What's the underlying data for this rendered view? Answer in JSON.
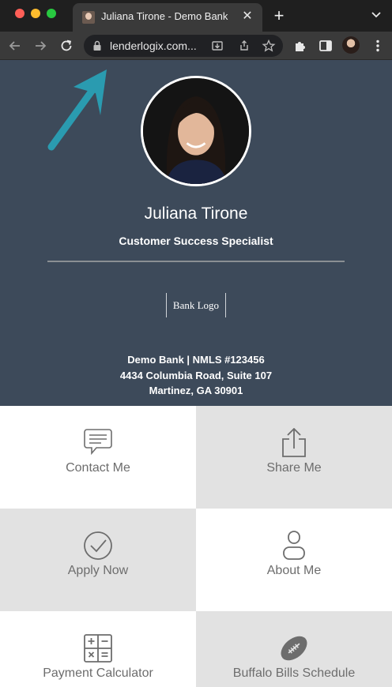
{
  "browser": {
    "tab_title": "Juliana Tirone - Demo Bank",
    "url": "lenderlogix.com..."
  },
  "profile": {
    "name": "Juliana Tirone",
    "title": "Customer Success Specialist",
    "bank_logo": "Bank Logo",
    "company_line": "Demo Bank | NMLS #123456",
    "address_line": "4434 Columbia Road, Suite 107",
    "city_line": "Martinez, GA 30901"
  },
  "tiles": [
    {
      "label": "Contact Me",
      "icon": "chat-bubble-icon"
    },
    {
      "label": "Share Me",
      "icon": "share-icon"
    },
    {
      "label": "Apply Now",
      "icon": "check-circle-icon"
    },
    {
      "label": "About Me",
      "icon": "person-icon"
    },
    {
      "label": "Payment Calculator",
      "icon": "calculator-icon"
    },
    {
      "label": "Buffalo Bills Schedule",
      "icon": "football-icon"
    }
  ],
  "colors": {
    "header_bg": "#3d4a5a",
    "tile_white": "#ffffff",
    "tile_grey": "#e2e2e2",
    "tile_text": "#6d6d6d",
    "annotation_arrow": "#2a9bb0"
  }
}
